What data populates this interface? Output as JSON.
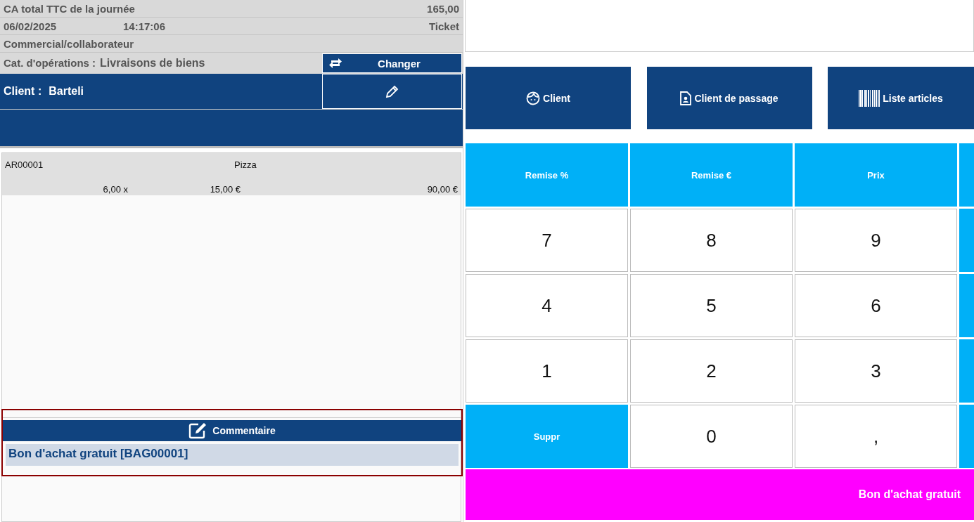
{
  "summary": {
    "total_label": "CA total TTC de la journée",
    "total_value": "165,00",
    "date": "06/02/2025",
    "time": "14:17:06",
    "doc_type": "Ticket",
    "salesperson_label": "Commercial/collaborateur",
    "category_label": "Cat. d'opérations :",
    "category_value": "Livraisons de biens",
    "change_button": "Changer",
    "client_label": "Client :",
    "client_value": "Barteli"
  },
  "ticket_lines": [
    {
      "code": "AR00001",
      "name": "Pizza",
      "quantity": "6,00 x",
      "unit_price": "15,00 €",
      "total": "90,00 €"
    }
  ],
  "comment": {
    "title": "Commentaire",
    "text": "Bon d'achat gratuit [BAG00001]"
  },
  "top_buttons": [
    {
      "kind": "client",
      "label": "Client"
    },
    {
      "kind": "walkin",
      "label": "Client de passage"
    },
    {
      "kind": "items",
      "label": "Liste articles"
    }
  ],
  "keypad": [
    {
      "kind": "action",
      "label": "Remise %"
    },
    {
      "kind": "action",
      "label": "Remise €"
    },
    {
      "kind": "action",
      "label": "Prix"
    },
    {
      "kind": "side"
    },
    {
      "kind": "digit",
      "label": "7"
    },
    {
      "kind": "digit",
      "label": "8"
    },
    {
      "kind": "digit",
      "label": "9"
    },
    {
      "kind": "side"
    },
    {
      "kind": "digit",
      "label": "4"
    },
    {
      "kind": "digit",
      "label": "5"
    },
    {
      "kind": "digit",
      "label": "6"
    },
    {
      "kind": "side"
    },
    {
      "kind": "digit",
      "label": "1"
    },
    {
      "kind": "digit",
      "label": "2"
    },
    {
      "kind": "digit",
      "label": "3"
    },
    {
      "kind": "side"
    },
    {
      "kind": "action",
      "label": "Suppr"
    },
    {
      "kind": "digit",
      "label": "0"
    },
    {
      "kind": "digit",
      "label": ","
    },
    {
      "kind": "side"
    }
  ],
  "voucher_button": "Bon d'achat gratuit"
}
